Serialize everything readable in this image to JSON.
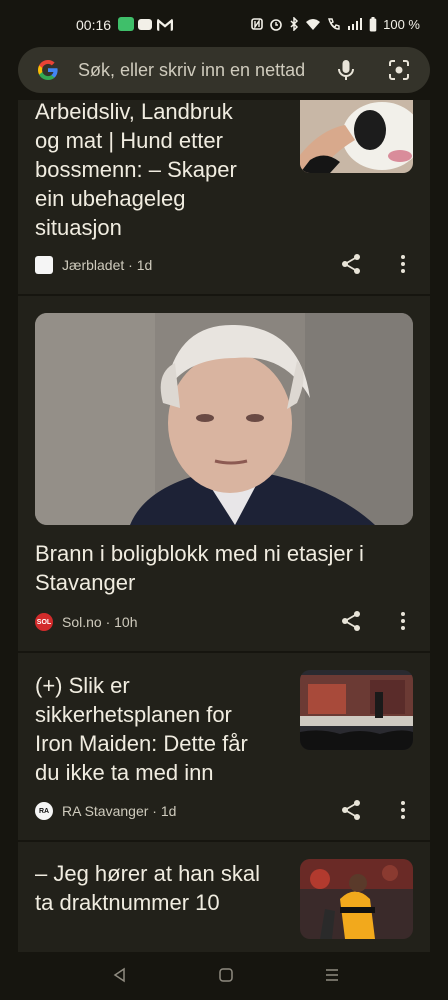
{
  "status_bar": {
    "time": "00:16",
    "battery": "100 %",
    "app_icons": [
      "notification-app-icon",
      "youtube-icon",
      "gmail-icon"
    ],
    "system_icons": [
      "nfc-icon",
      "alarm-icon",
      "bluetooth-icon",
      "wifi-icon",
      "wifi-calling-icon",
      "signal-icon",
      "battery-icon"
    ]
  },
  "search": {
    "placeholder": "Søk, eller skriv inn en nettad"
  },
  "cards": [
    {
      "title_lines": [
        "Arbeidsliv, Landbruk",
        "og mat | Hund etter",
        "bossmenn: – Skaper",
        "ein ubehageleg",
        "situasjon"
      ],
      "source": "Jærbladet · 1d",
      "favicon_text": ""
    },
    {
      "title_lines": [
        "Brann i boligblokk med ni etasjer i",
        "Stavanger"
      ],
      "source": "Sol.no · 10h",
      "favicon_text": "SOL"
    },
    {
      "title_lines": [
        "(+) Slik er",
        "sikkerhetsplanen for",
        "Iron Maiden: Dette får",
        "du ikke ta med inn"
      ],
      "source": "RA Stavanger · 1d",
      "favicon_text": "RA"
    },
    {
      "title_lines": [
        "– Jeg hører at han skal",
        "ta draktnummer 10"
      ],
      "source": "",
      "favicon_text": ""
    }
  ],
  "colors": {
    "background": "#16150f",
    "card": "#22211a",
    "search_bar": "#34332a",
    "text": "#f0ece0"
  }
}
